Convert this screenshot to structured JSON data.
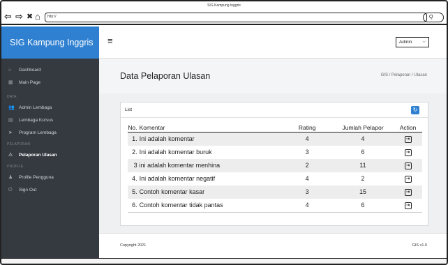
{
  "browser": {
    "title": "SIG Kampung Inggris",
    "url": "http://",
    "nav_back": "⇦",
    "nav_forward": "⇨",
    "nav_stop": "✖",
    "nav_home": "⌂",
    "go_glyph": "Q"
  },
  "sidebar": {
    "brand": "SIG Kampung Inggris",
    "items_top": [
      {
        "label": "Dashboard",
        "icon": "home-icon",
        "glyph": "⌂"
      },
      {
        "label": "Main Page",
        "icon": "grid-icon",
        "glyph": "▦"
      }
    ],
    "section_data": "DATA",
    "items_data": [
      {
        "label": "Admin Lembaga",
        "icon": "users-icon",
        "glyph": "👥"
      },
      {
        "label": "Lembaga Kursus",
        "icon": "book-icon",
        "glyph": "▤"
      },
      {
        "label": "Program Lembaga",
        "icon": "send-icon",
        "glyph": "➤"
      }
    ],
    "section_pelaporan": "PELAPORAN",
    "items_pelaporan": [
      {
        "label": "Pelaporan Ulasan",
        "icon": "warning-icon",
        "glyph": "⚠"
      }
    ],
    "section_profile": "PROFILE",
    "items_profile": [
      {
        "label": "Profile Pengguna",
        "icon": "user-icon",
        "glyph": "♟"
      },
      {
        "label": "Sign Out",
        "icon": "power-icon",
        "glyph": "⏻"
      }
    ]
  },
  "topbar": {
    "menu_glyph": "≡",
    "user_select": "Admin",
    "user_select_chevron": "⌵"
  },
  "content": {
    "page_title": "Data Pelaporan Ulasan",
    "breadcrumb": "GIS / Pelaporan / Ulasan",
    "card_title": "List",
    "refresh_glyph": "↻",
    "columns": [
      "No.",
      "Komentar",
      "Rating",
      "Jumlah Pelapor",
      "Action"
    ],
    "rows": [
      {
        "no": "1.",
        "komentar": "Ini adalah komentar",
        "rating": "4",
        "jumlah": "4"
      },
      {
        "no": "2.",
        "komentar": "Ini adalah komentar buruk",
        "rating": "3",
        "jumlah": "6"
      },
      {
        "no": "3",
        "komentar": "ini adalah komentar menhina",
        "rating": "2",
        "jumlah": "11"
      },
      {
        "no": "4.",
        "komentar": "Ini adalah komentar negatif",
        "rating": "4",
        "jumlah": "2"
      },
      {
        "no": "5.",
        "komentar": "Contoh komentar kasar",
        "rating": "3",
        "jumlah": "15"
      },
      {
        "no": "6.",
        "komentar": "Contoh komentar tidak pantas",
        "rating": "4",
        "jumlah": "6"
      }
    ],
    "action_glyph": "⇥"
  },
  "footer": {
    "copyright": "Copyright 2021",
    "version": "GIS v1.0"
  },
  "colors": {
    "brand": "#2f80d1",
    "sidebar_bg": "#343a40",
    "content_bg": "#eef0f2"
  }
}
